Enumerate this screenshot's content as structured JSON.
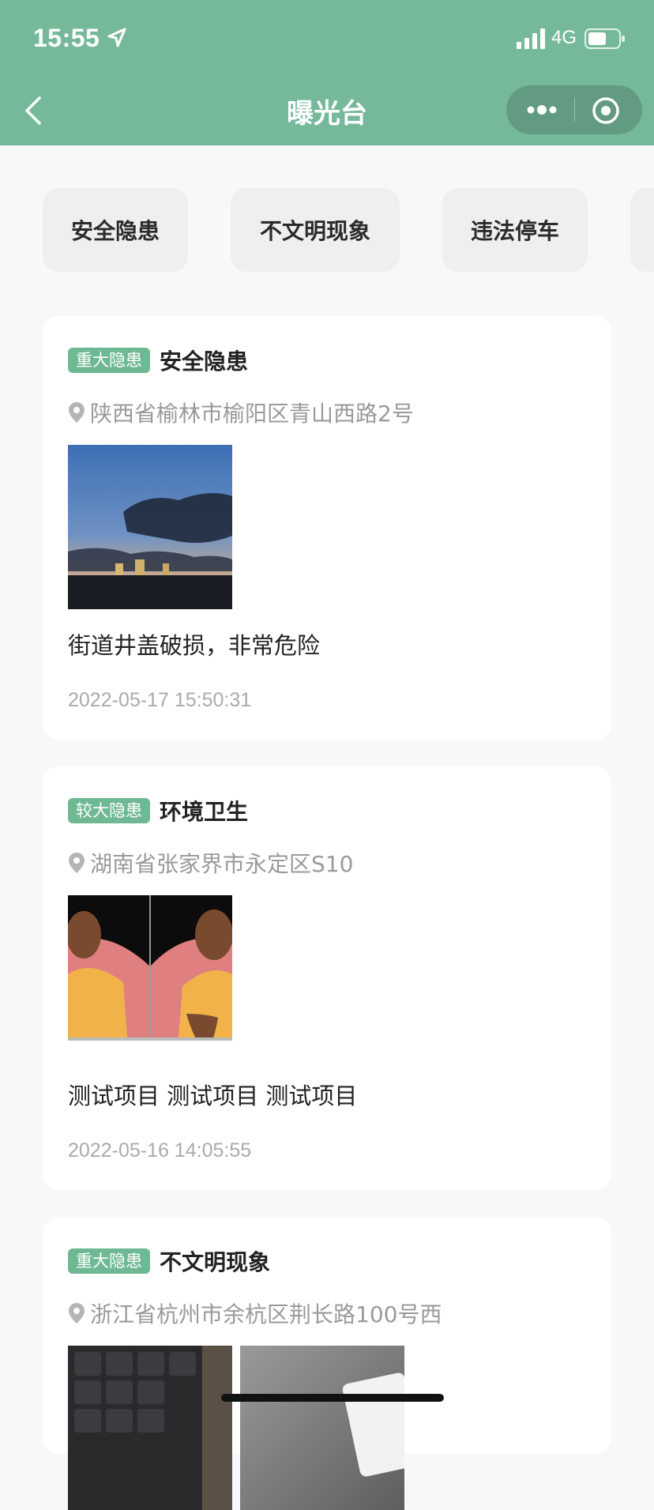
{
  "status_bar": {
    "time": "15:55",
    "network": "4G"
  },
  "nav": {
    "title": "曝光台"
  },
  "tabs": [
    "安全隐患",
    "不文明现象",
    "违法停车"
  ],
  "posts": [
    {
      "badge": "重大隐患",
      "category": "安全隐患",
      "address": "陕西省榆林市榆阳区青山西路2号",
      "description": "街道井盖破损，非常危险",
      "time": "2022-05-17 15:50:31"
    },
    {
      "badge": "较大隐患",
      "category": "环境卫生",
      "address": "湖南省张家界市永定区S10",
      "description": "测试项目 测试项目 测试项目",
      "time": "2022-05-16 14:05:55"
    },
    {
      "badge": "重大隐患",
      "category": "不文明现象",
      "address": "浙江省杭州市余杭区荆长路100号西"
    }
  ],
  "colors": {
    "header": "#75b99a",
    "badge": "#6fb894",
    "background": "#f7f8fa"
  },
  "icons": [
    "location-arrow-icon",
    "signal-icon",
    "battery-icon",
    "back-arrow-icon",
    "more-dots-icon",
    "close-circle-icon",
    "location-pin-icon"
  ]
}
